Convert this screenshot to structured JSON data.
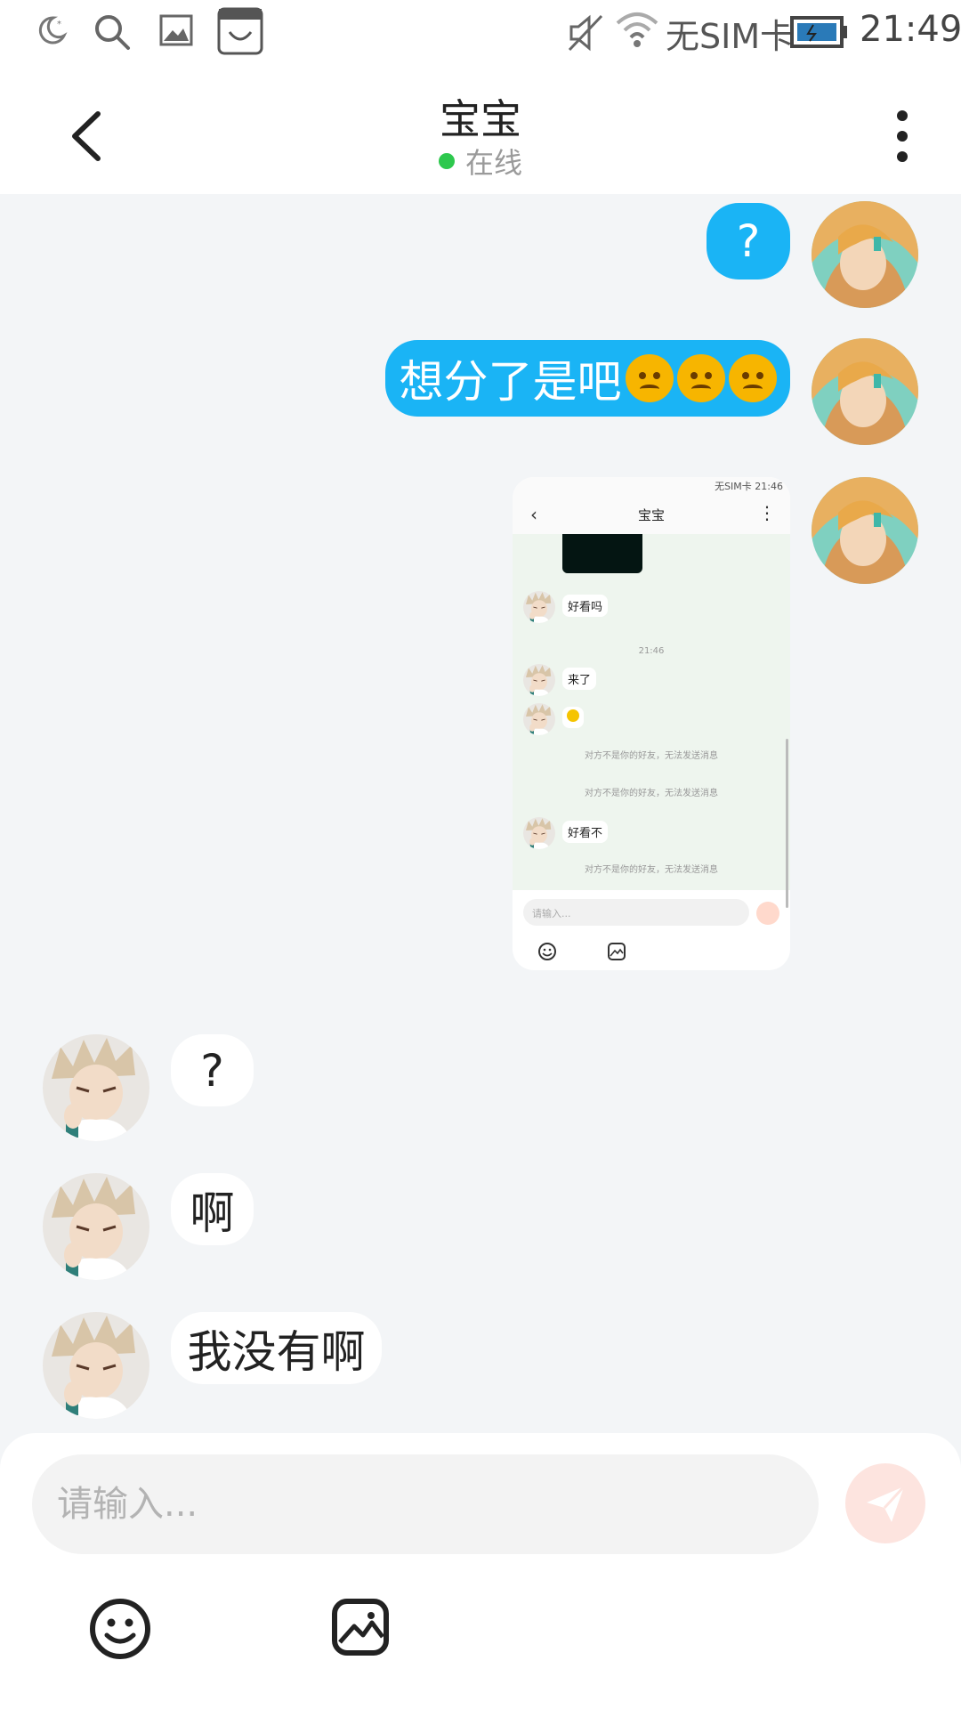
{
  "status_bar": {
    "carrier": "无SIM卡",
    "time": "21:49"
  },
  "header": {
    "title": "宝宝",
    "status": "在线"
  },
  "messages": [
    {
      "side": "me",
      "text": "?"
    },
    {
      "side": "me",
      "text": "想分了是吧",
      "emoji": "angry-emoji"
    },
    {
      "side": "me",
      "type": "image"
    },
    {
      "side": "other",
      "text": "?"
    },
    {
      "side": "other",
      "text": "啊"
    },
    {
      "side": "other",
      "text": "我没有啊"
    }
  ],
  "shared_screenshot": {
    "status_text": "无SIM卡 21:46",
    "title": "宝宝",
    "msg1": "好看吗",
    "time": "21:46",
    "msg2": "来了",
    "sys1": "对方不是你的好友，无法发送消息",
    "sys2": "对方不是你的好友，无法发送消息",
    "msg3": "好看不",
    "sys3": "对方不是你的好友，无法发送消息",
    "placeholder": "请输入..."
  },
  "input": {
    "placeholder": "请输入..."
  },
  "colors": {
    "my_bubble": "#1ab4f5",
    "online_dot": "#2dc84d",
    "send_button": "#fde4df"
  }
}
